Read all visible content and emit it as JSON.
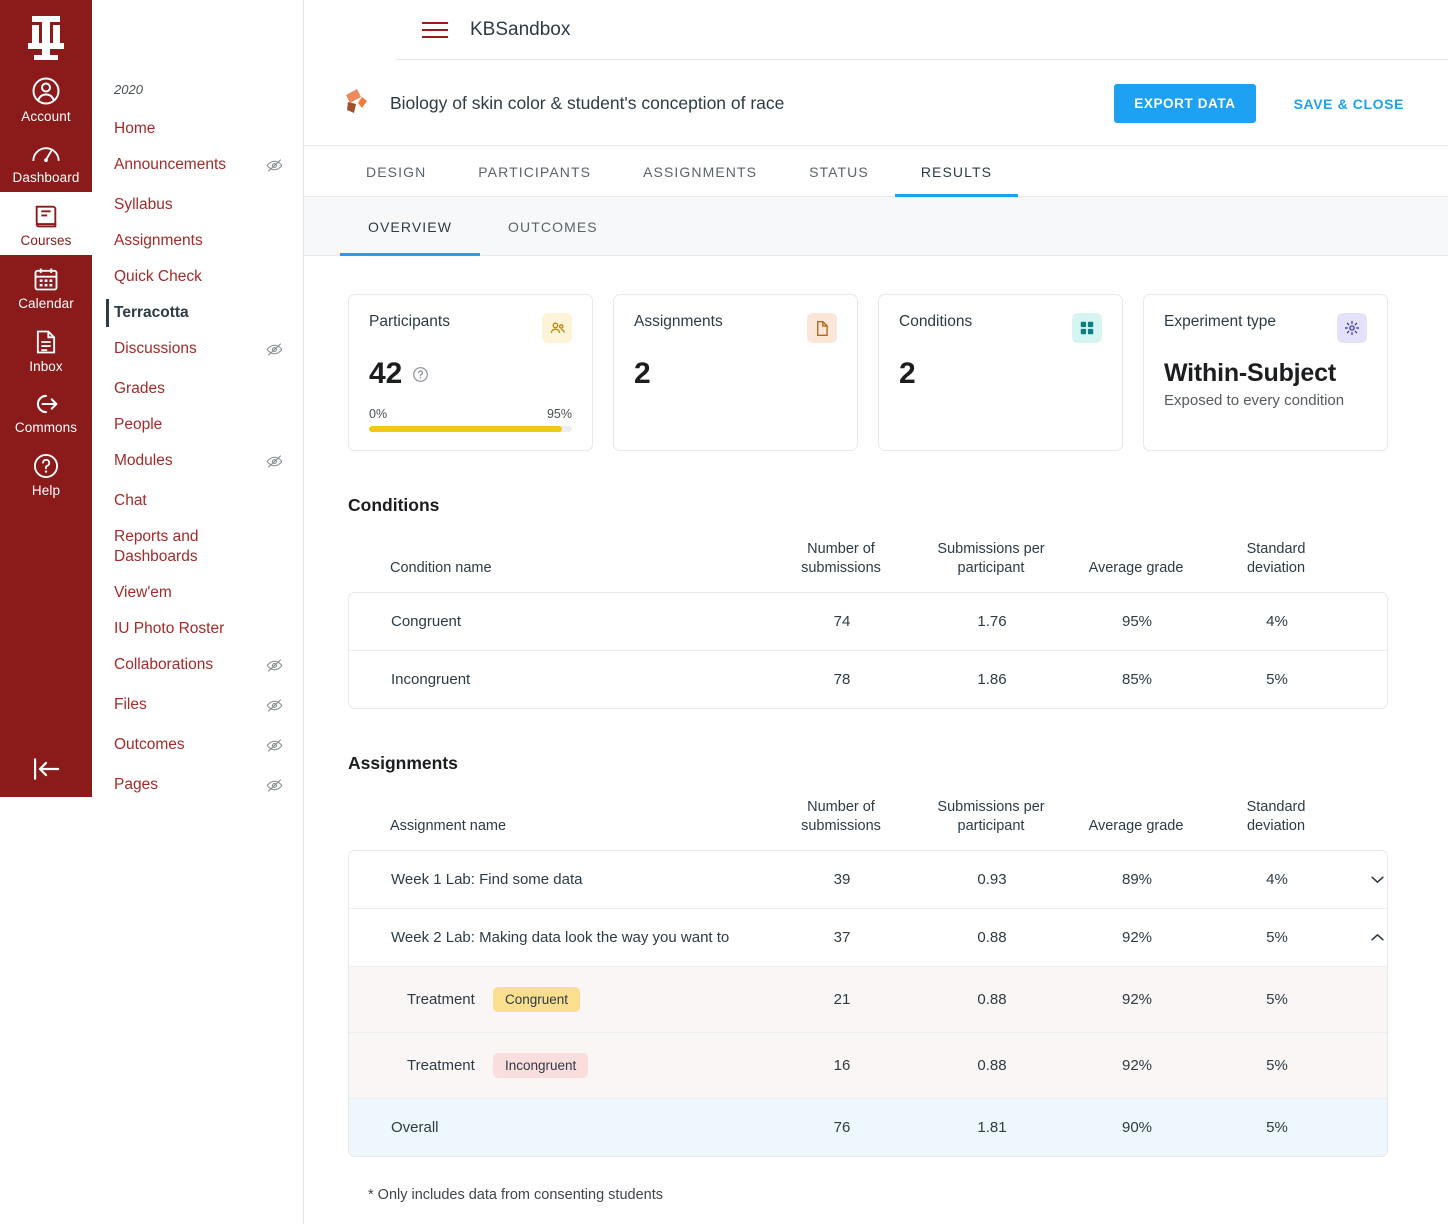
{
  "globalnav": {
    "logo_alt": "Indiana University",
    "items": [
      {
        "label": "Account",
        "icon": "account-icon",
        "active": false
      },
      {
        "label": "Dashboard",
        "icon": "dashboard-icon",
        "active": false
      },
      {
        "label": "Courses",
        "icon": "courses-icon",
        "active": true
      },
      {
        "label": "Calendar",
        "icon": "calendar-icon",
        "active": false
      },
      {
        "label": "Inbox",
        "icon": "inbox-icon",
        "active": false
      },
      {
        "label": "Commons",
        "icon": "commons-icon",
        "active": false
      },
      {
        "label": "Help",
        "icon": "help-icon",
        "active": false
      }
    ],
    "collapse_label": "Collapse navigation"
  },
  "topbar": {
    "menu_label": "Menu",
    "course_name": "KBSandbox"
  },
  "coursenav": {
    "term": "2020",
    "items": [
      {
        "label": "Home",
        "hidden": false,
        "active": false
      },
      {
        "label": "Announcements",
        "hidden": true,
        "active": false
      },
      {
        "label": "Syllabus",
        "hidden": false,
        "active": false
      },
      {
        "label": "Assignments",
        "hidden": false,
        "active": false
      },
      {
        "label": "Quick Check",
        "hidden": false,
        "active": false
      },
      {
        "label": "Terracotta",
        "hidden": false,
        "active": true
      },
      {
        "label": "Discussions",
        "hidden": true,
        "active": false
      },
      {
        "label": "Grades",
        "hidden": false,
        "active": false
      },
      {
        "label": "People",
        "hidden": false,
        "active": false
      },
      {
        "label": "Modules",
        "hidden": true,
        "active": false
      },
      {
        "label": "Chat",
        "hidden": false,
        "active": false
      },
      {
        "label": "Reports and Dashboards",
        "hidden": false,
        "active": false
      },
      {
        "label": "View'em",
        "hidden": false,
        "active": false
      },
      {
        "label": "IU Photo Roster",
        "hidden": false,
        "active": false
      },
      {
        "label": "Collaborations",
        "hidden": true,
        "active": false
      },
      {
        "label": "Files",
        "hidden": true,
        "active": false
      },
      {
        "label": "Outcomes",
        "hidden": true,
        "active": false
      },
      {
        "label": "Pages",
        "hidden": true,
        "active": false
      }
    ]
  },
  "experiment": {
    "title": "Biology of skin color & student's conception of race",
    "export_label": "EXPORT DATA",
    "save_close_label": "SAVE & CLOSE",
    "accent_color": "#1da1f2"
  },
  "tabs": {
    "main": [
      {
        "label": "DESIGN",
        "active": false
      },
      {
        "label": "PARTICIPANTS",
        "active": false
      },
      {
        "label": "ASSIGNMENTS",
        "active": false
      },
      {
        "label": "STATUS",
        "active": false
      },
      {
        "label": "RESULTS",
        "active": true
      }
    ],
    "sub": [
      {
        "label": "OVERVIEW",
        "active": true
      },
      {
        "label": "OUTCOMES",
        "active": false
      }
    ]
  },
  "cards": {
    "participants": {
      "label": "Participants",
      "value": "42",
      "icon": "people-icon",
      "help_icon": "help-circle-icon",
      "progress_min": "0%",
      "progress_max": "95%",
      "progress_percent": 95,
      "bar_color": "#f5c518"
    },
    "assignments": {
      "label": "Assignments",
      "value": "2",
      "icon": "document-icon"
    },
    "conditions": {
      "label": "Conditions",
      "value": "2",
      "icon": "grid-icon"
    },
    "experiment_type": {
      "label": "Experiment type",
      "value": "Within-Subject",
      "sub": "Exposed to every condition",
      "icon": "gear-icon"
    }
  },
  "conditions_section": {
    "title": "Conditions",
    "columns": [
      "Condition name",
      "Number of submissions",
      "Submissions per participant",
      "Average grade",
      "Standard deviation"
    ],
    "rows": [
      {
        "name": "Congruent",
        "submissions": "74",
        "per_participant": "1.76",
        "avg_grade": "95%",
        "std_dev": "4%"
      },
      {
        "name": "Incongruent",
        "submissions": "78",
        "per_participant": "1.86",
        "avg_grade": "85%",
        "std_dev": "5%"
      }
    ]
  },
  "assignments_section": {
    "title": "Assignments",
    "columns": [
      "Assignment name",
      "Number of submissions",
      "Submissions per participant",
      "Average grade",
      "Standard deviation"
    ],
    "rows": [
      {
        "type": "assignment",
        "name": "Week 1 Lab: Find some data",
        "submissions": "39",
        "per_participant": "0.93",
        "avg_grade": "89%",
        "std_dev": "4%",
        "expanded": false,
        "chevron": "chevron-down-icon"
      },
      {
        "type": "assignment",
        "name": "Week 2 Lab: Making data look the way you want to",
        "submissions": "37",
        "per_participant": "0.88",
        "avg_grade": "92%",
        "std_dev": "5%",
        "expanded": true,
        "chevron": "chevron-up-icon"
      },
      {
        "type": "treatment",
        "name": "Treatment",
        "chip": "Congruent",
        "chip_color": "#fae08e",
        "submissions": "21",
        "per_participant": "0.88",
        "avg_grade": "92%",
        "std_dev": "5%"
      },
      {
        "type": "treatment",
        "name": "Treatment",
        "chip": "Incongruent",
        "chip_color": "#fadede",
        "submissions": "16",
        "per_participant": "0.88",
        "avg_grade": "92%",
        "std_dev": "5%"
      },
      {
        "type": "overall",
        "name": "Overall",
        "submissions": "76",
        "per_participant": "1.81",
        "avg_grade": "90%",
        "std_dev": "5%"
      }
    ]
  },
  "footnote": "* Only includes data from consenting students"
}
